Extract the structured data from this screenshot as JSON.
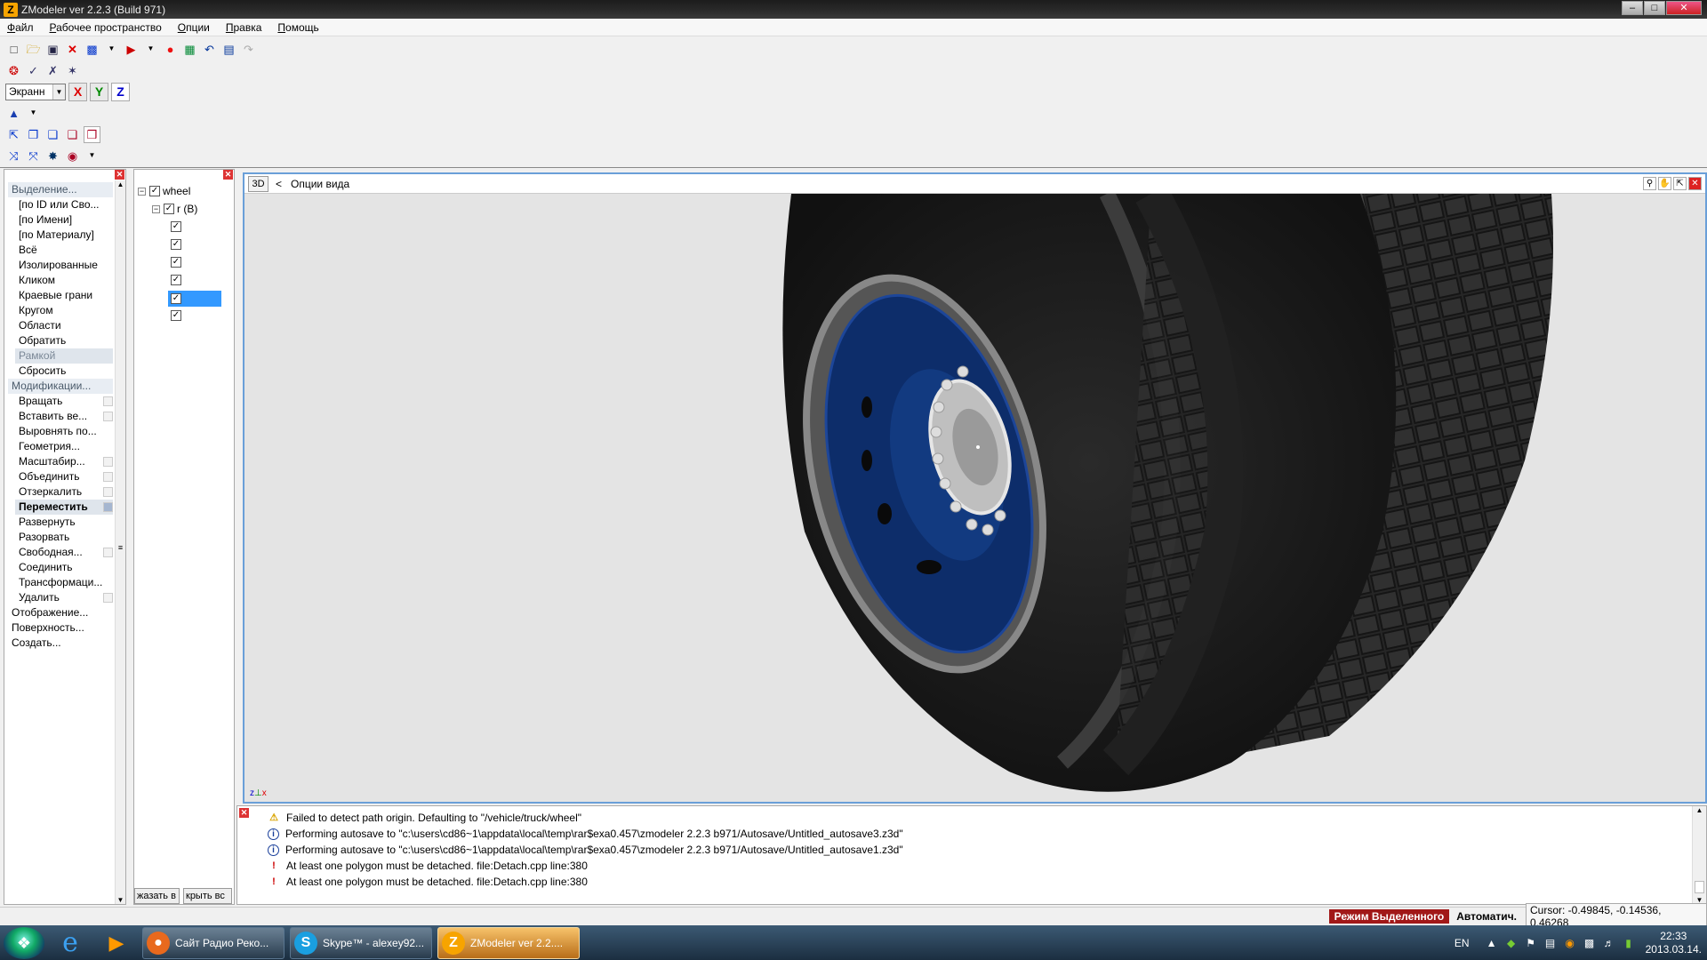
{
  "window": {
    "title": "ZModeler ver 2.2.3 (Build 971)",
    "app_icon": "Z",
    "min": "–",
    "max": "□",
    "close": "✕"
  },
  "menu": [
    "Файл",
    "Рабочее пространство",
    "Опции",
    "Правка",
    "Помощь"
  ],
  "toolbar": {
    "coord_system": "Экранн",
    "axis_x": "X",
    "axis_y": "Y",
    "axis_z": "Z"
  },
  "commands": [
    {
      "label": "Выделение...",
      "kind": "cat"
    },
    {
      "label": "[по ID или Сво...",
      "kind": "sub"
    },
    {
      "label": "[по Имени]",
      "kind": "sub"
    },
    {
      "label": "[по Материалу]",
      "kind": "sub"
    },
    {
      "label": "Всё",
      "kind": "sub"
    },
    {
      "label": "Изолированные",
      "kind": "sub"
    },
    {
      "label": "Кликом",
      "kind": "sub"
    },
    {
      "label": "Краевые грани",
      "kind": "sub"
    },
    {
      "label": "Кругом",
      "kind": "sub"
    },
    {
      "label": "Области",
      "kind": "sub"
    },
    {
      "label": "Обратить",
      "kind": "sub"
    },
    {
      "label": "Рамкой",
      "kind": "hl"
    },
    {
      "label": "Сбросить",
      "kind": "sub"
    },
    {
      "label": "Модификации...",
      "kind": "cat"
    },
    {
      "label": "Вращать",
      "kind": "sub",
      "opt": true
    },
    {
      "label": "Вставить ве...",
      "kind": "sub",
      "opt": true
    },
    {
      "label": "Выровнять по...",
      "kind": "sub"
    },
    {
      "label": "Геометрия...",
      "kind": "sub"
    },
    {
      "label": "Масштабир...",
      "kind": "sub",
      "opt": true
    },
    {
      "label": "Объединить",
      "kind": "sub",
      "opt": true
    },
    {
      "label": "Отзеркалить",
      "kind": "sub",
      "opt": true
    },
    {
      "label": "Переместить",
      "kind": "active",
      "opt": true
    },
    {
      "label": "Развернуть",
      "kind": "sub"
    },
    {
      "label": "Разорвать",
      "kind": "sub"
    },
    {
      "label": "Свободная...",
      "kind": "sub",
      "opt": true
    },
    {
      "label": "Соединить",
      "kind": "sub"
    },
    {
      "label": "Трансформаци...",
      "kind": "sub"
    },
    {
      "label": "Удалить",
      "kind": "sub",
      "opt": true
    },
    {
      "label": "Отображение...",
      "kind": "top"
    },
    {
      "label": "Поверхность...",
      "kind": "top"
    },
    {
      "label": "Создать...",
      "kind": "top"
    }
  ],
  "tree": {
    "root": "wheel",
    "child": "r (B)",
    "leaf_count": 6,
    "selected_leaf": 4,
    "btn_show": "жазать в",
    "btn_hide": "крыть вс"
  },
  "viewport": {
    "mode_label": "3D",
    "options_label": "Опции вида",
    "back_arrow": "<"
  },
  "log": [
    {
      "type": "warn",
      "text": "Failed to detect path origin. Defaulting to \"/vehicle/truck/wheel\""
    },
    {
      "type": "info",
      "text": "Performing autosave to \"c:\\users\\cd86~1\\appdata\\local\\temp\\rar$exa0.457\\zmodeler 2.2.3 b971/Autosave/Untitled_autosave3.z3d\""
    },
    {
      "type": "info",
      "text": "Performing autosave to \"c:\\users\\cd86~1\\appdata\\local\\temp\\rar$exa0.457\\zmodeler 2.2.3 b971/Autosave/Untitled_autosave1.z3d\""
    },
    {
      "type": "err",
      "text": "At least one polygon must be detached. file:Detach.cpp line:380"
    },
    {
      "type": "err",
      "text": "At least one polygon must be detached. file:Detach.cpp line:380"
    }
  ],
  "status": {
    "mode": "Режим Выделенного",
    "auto": "Автоматич.",
    "cursor": "Cursor: -0.49845, -0.14536, 0.46268"
  },
  "taskbar": {
    "tasks": [
      {
        "label": "Сайт Радио Реко...",
        "icon": "firefox-icon",
        "glyph": "●",
        "color": "#e8691d"
      },
      {
        "label": "Skype™ - alexey92...",
        "icon": "skype-icon",
        "glyph": "S",
        "color": "#1a9fe0"
      },
      {
        "label": "ZModeler ver 2.2....",
        "icon": "zmodeler-icon",
        "glyph": "Z",
        "color": "#f7a400",
        "active": true
      }
    ],
    "lang": "EN",
    "time": "22:33",
    "date": "2013.03.14."
  }
}
